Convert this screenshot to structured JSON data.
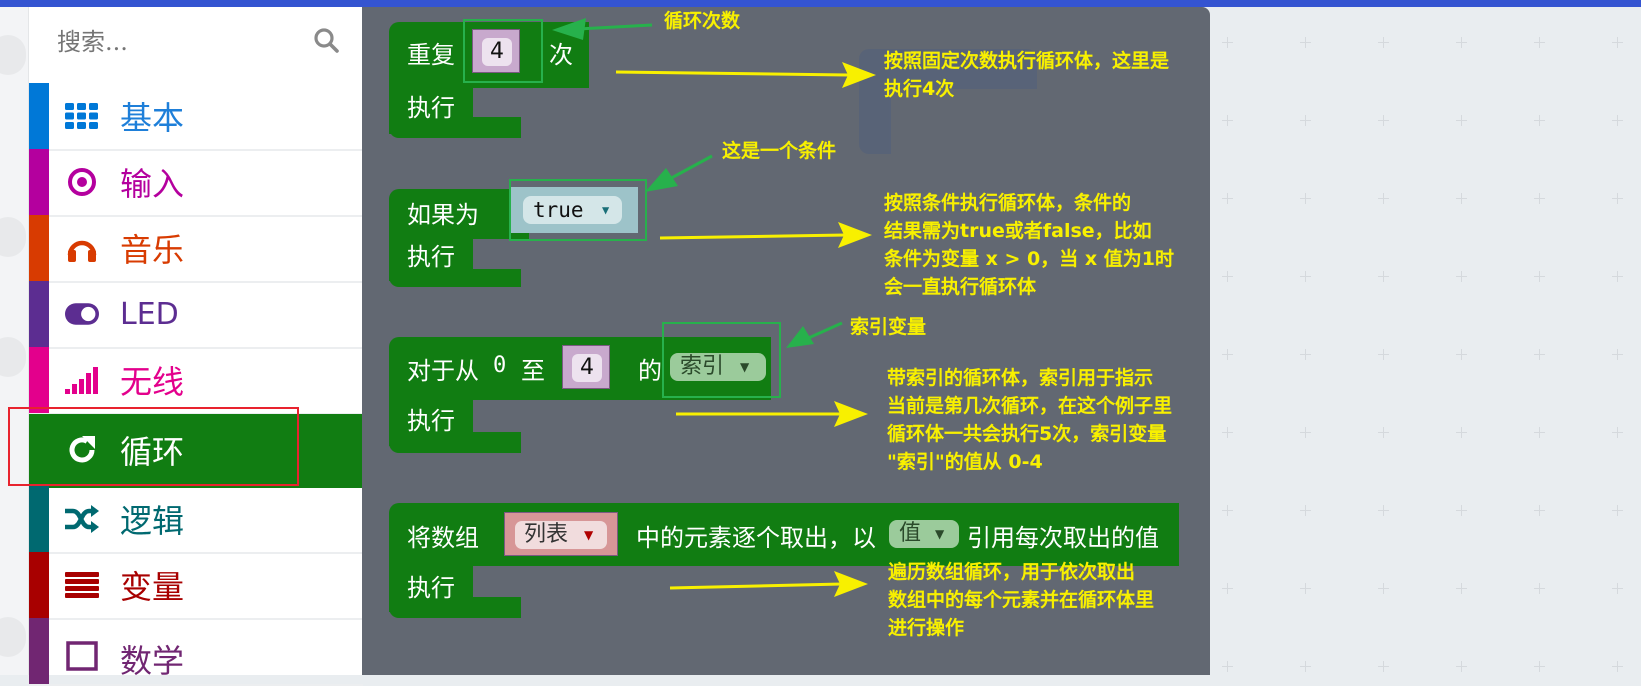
{
  "search": {
    "placeholder": "搜索..."
  },
  "categories": [
    {
      "label": "基本",
      "icon": "grid-icon",
      "color": "#1e7fd9"
    },
    {
      "label": "输入",
      "icon": "target-icon",
      "color": "#b4009e"
    },
    {
      "label": "音乐",
      "icon": "headphones-icon",
      "color": "#d83b01"
    },
    {
      "label": "LED",
      "icon": "toggle-icon",
      "color": "#5c2d91"
    },
    {
      "label": "无线",
      "icon": "signal-bars-icon",
      "color": "#e3008c"
    },
    {
      "label": "循环",
      "icon": "refresh-icon",
      "color": "#117d12",
      "selected": true
    },
    {
      "label": "逻辑",
      "icon": "shuffle-icon",
      "color": "#006970"
    },
    {
      "label": "变量",
      "icon": "list-icon",
      "color": "#a80000"
    },
    {
      "label": "数学",
      "icon": "calculator-icon",
      "color": "#712672"
    }
  ],
  "blocks": {
    "repeat": {
      "label": "重复",
      "times": "4",
      "suffix": "次",
      "do": "执行"
    },
    "while": {
      "label": "如果为",
      "condition": "true",
      "do": "执行"
    },
    "for": {
      "label": "对于从",
      "from": "0",
      "to_label": "至",
      "to": "4",
      "of_label": "的",
      "var": "索引",
      "do": "执行"
    },
    "foreach": {
      "label": "将数组",
      "list": "列表",
      "middle": "中的元素逐个取出，以",
      "var": "值",
      "suffix": "引用每次取出的值",
      "do": "执行"
    }
  },
  "annotations": {
    "repeat_count": "循环次数",
    "repeat_desc": [
      "按照固定次数执行循环体，这里是",
      "执行4次"
    ],
    "condition": "这是一个条件",
    "while_desc": [
      "按照条件执行循环体，条件的",
      "结果需为true或者false，比如",
      "条件为变量 x > 0，当 x 值为1时",
      "会一直执行循环体"
    ],
    "index_var": "索引变量",
    "for_desc": [
      "带索引的循环体，索引用于指示",
      "当前是第几次循环，在这个例子里",
      "循环体一共会执行5次，索引变量",
      "\"索引\"的值从 0-4"
    ],
    "foreach_desc": [
      "遍历数组循环，用于依次取出",
      "数组中的每个元素并在循环体里",
      "进行操作"
    ]
  },
  "colors": {
    "loop_block": "#117d12",
    "flyout_bg": "#626872",
    "annotation_text": "#f8f000",
    "highlight_green": "#27b14c",
    "highlight_red": "#e8232e",
    "topbar": "#3454d1"
  }
}
